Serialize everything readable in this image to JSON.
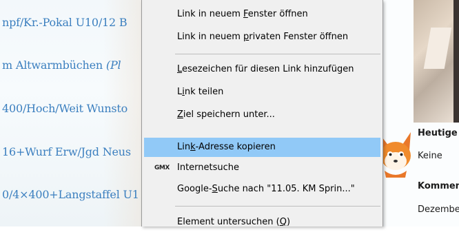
{
  "background": {
    "event_links": [
      "npf/Kr.-Pokal U10/12 B",
      "m Altwarmbüchen",
      "(Pl",
      "400/Hoch/Weit Wunsto",
      "16+Wurf Erw/Jgd Neus",
      "0/4×400+Langstaffel U1"
    ],
    "link_color": "#3b7fbf",
    "sidebar": {
      "heading_today": "Heutige",
      "today_value": "Keine",
      "heading_comments": "Kommen",
      "comments_value": "Dezembe"
    }
  },
  "context_menu": {
    "highlight_color": "#91c9f7",
    "items": [
      {
        "pre": "Link in neuem ",
        "acc": "F",
        "post": "enster öffnen"
      },
      {
        "pre": "Link in neuem ",
        "acc": "p",
        "post": "rivaten Fenster öffnen"
      },
      {
        "pre": "",
        "acc": "L",
        "post": "esezeichen für diesen Link hinzufügen"
      },
      {
        "pre": "L",
        "acc": "i",
        "post": "nk teilen"
      },
      {
        "pre": "",
        "acc": "Z",
        "post": "iel speichern unter..."
      },
      {
        "pre": "Lin",
        "acc": "k",
        "post": "-Adresse kopieren"
      },
      {
        "pre": "Internetsuche",
        "acc": "",
        "post": ""
      },
      {
        "pre": "Google-",
        "acc": "S",
        "post": "uche nach \"11.05. KM Sprin...\""
      },
      {
        "pre": "Element untersuchen (",
        "acc": "Q",
        "post": ")"
      }
    ],
    "gmx_icon_text": "GMX"
  }
}
